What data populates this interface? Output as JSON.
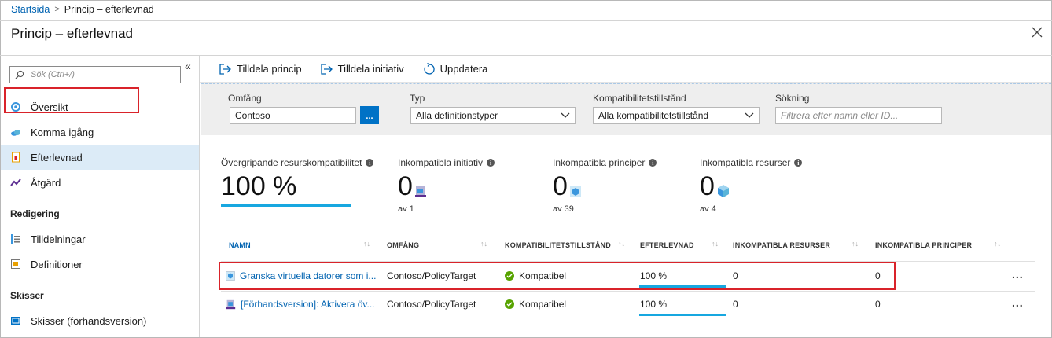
{
  "breadcrumb": {
    "home": "Startsida",
    "separator": ">",
    "current": "Princip – efterlevnad"
  },
  "page": {
    "title": "Princip – efterlevnad"
  },
  "sidebar": {
    "collapse": "«",
    "search_placeholder": "Sök (Ctrl+/)",
    "items": [
      {
        "label": "Översikt",
        "icon": "overview-icon"
      },
      {
        "label": "Komma igång",
        "icon": "cloud-icon"
      },
      {
        "label": "Efterlevnad",
        "icon": "compliance-icon",
        "active": true
      },
      {
        "label": "Åtgärd",
        "icon": "remediation-icon"
      }
    ],
    "sections": [
      {
        "header": "Redigering",
        "items": [
          {
            "label": "Tilldelningar",
            "icon": "assignments-icon"
          },
          {
            "label": "Definitioner",
            "icon": "definitions-icon"
          }
        ]
      },
      {
        "header": "Skisser",
        "items": [
          {
            "label": "Skisser (förhandsversion)",
            "icon": "blueprint-icon"
          }
        ]
      }
    ]
  },
  "toolbar": {
    "assign_policy": "Tilldela princip",
    "assign_initiative": "Tilldela initiativ",
    "refresh": "Uppdatera"
  },
  "filters": {
    "scope": {
      "label": "Omfång",
      "value": "Contoso",
      "button": "..."
    },
    "type": {
      "label": "Typ",
      "value": "Alla definitionstyper"
    },
    "compliance_state": {
      "label": "Kompatibilitetstillstånd",
      "value": "Alla kompatibilitetstillstånd"
    },
    "search": {
      "label": "Sökning",
      "placeholder": "Filtrera efter namn eller ID..."
    }
  },
  "summary": {
    "overall": {
      "label": "Övergripande resurskompatibilitet",
      "value": "100 %",
      "percent": 100
    },
    "noncompliant_initiatives": {
      "label": "Inkompatibla initiativ",
      "value": "0",
      "sub": "av 1"
    },
    "noncompliant_policies": {
      "label": "Inkompatibla principer",
      "value": "0",
      "sub": "av 39"
    },
    "noncompliant_resources": {
      "label": "Inkompatibla resurser",
      "value": "0",
      "sub": "av 4"
    }
  },
  "table": {
    "columns": [
      "NAMN",
      "OMFÅNG",
      "KOMPATIBILITETSTILLSTÅND",
      "EFTERLEVNAD",
      "INKOMPATIBLA RESURSER",
      "INKOMPATIBLA PRINCIPER"
    ],
    "rows": [
      {
        "name": "Granska virtuella datorer som i...",
        "scope": "Contoso/PolicyTarget",
        "state": "Kompatibel",
        "compliance": "100 %",
        "compliance_percent": 100,
        "noncompliant_resources": "0",
        "noncompliant_policies": "0",
        "more": "..."
      },
      {
        "name": "[Förhandsversion]: Aktivera öv...",
        "scope": "Contoso/PolicyTarget",
        "state": "Kompatibel",
        "compliance": "100 %",
        "compliance_percent": 100,
        "noncompliant_resources": "0",
        "noncompliant_policies": "0",
        "more": "..."
      }
    ]
  },
  "colors": {
    "accent": "#0072c6",
    "link": "#0063b1",
    "progress": "#17a7e0",
    "success": "#57a300",
    "highlight": "#d9232a",
    "active_bg": "#dcebf7"
  }
}
